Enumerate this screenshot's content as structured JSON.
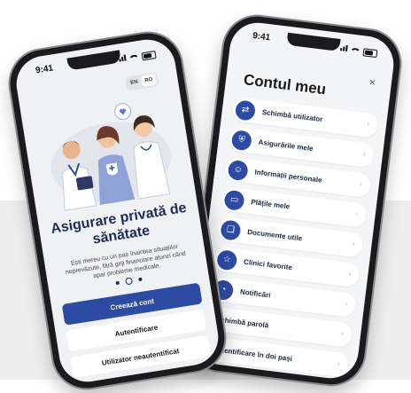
{
  "welcome_screen": {
    "status_time": "9:41",
    "lang_options": [
      "EN",
      "RO"
    ],
    "title": "Asigurare privată de sănătate",
    "subtitle": "Ești mereu cu un pas înaintea situațiilor neprevăzute, fără griji financiare atunci când apar probleme medicale.",
    "primary_button": "Creează cont",
    "login_button": "Autentificare",
    "guest_button": "Utilizator neautentificat",
    "pager": {
      "count": 3,
      "active": 2
    }
  },
  "menu_screen": {
    "status_time": "9:41",
    "title": "Contul meu",
    "close_label": "×",
    "items": [
      {
        "label": "Schimbă utilizator",
        "icon": "switch-user-icon",
        "glyph": "⇄"
      },
      {
        "label": "Asigurările mele",
        "icon": "shield-icon",
        "glyph": "⛨"
      },
      {
        "label": "Informații personale",
        "icon": "person-icon",
        "glyph": "☺"
      },
      {
        "label": "Plățile mele",
        "icon": "card-icon",
        "glyph": "▭"
      },
      {
        "label": "Documente utile",
        "icon": "document-icon",
        "glyph": "❏"
      },
      {
        "label": "Clinici favorite",
        "icon": "star-icon",
        "glyph": "☆"
      },
      {
        "label": "Notificări",
        "icon": "bell-icon",
        "glyph": "◔"
      },
      {
        "label": "Schimbă parolă",
        "icon": "",
        "glyph": ""
      },
      {
        "label": "Autentificare în doi pași",
        "icon": "",
        "glyph": ""
      }
    ],
    "chevron": "›"
  },
  "colors": {
    "brand": "#2e4ba3",
    "title_dark": "#1e2d55",
    "screen_bg": "#f0f1f3"
  }
}
